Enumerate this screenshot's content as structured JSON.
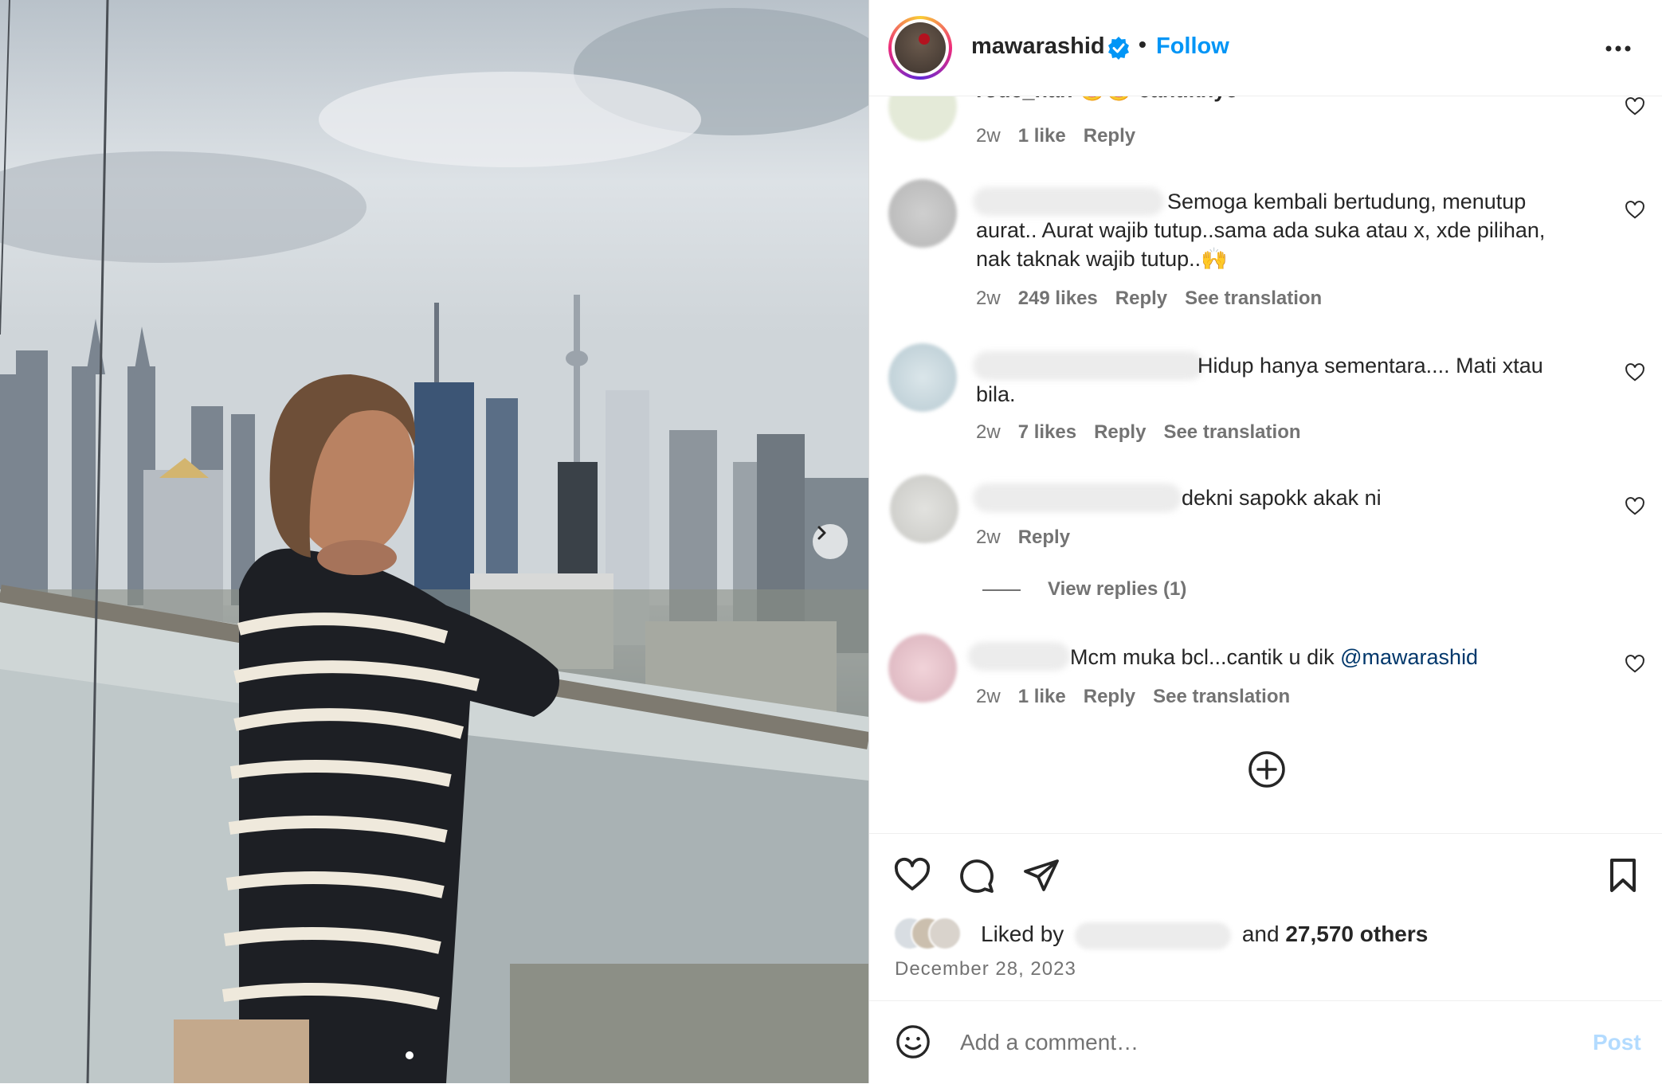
{
  "post": {
    "username": "mawarashid",
    "separator": "•",
    "follow_label": "Follow",
    "more_icon": "more-horizontal-icon",
    "verified_color": "#0095f6",
    "follow_color": "#0095f6"
  },
  "photo": {
    "next_icon": "chevron-right-icon",
    "carousel_index": 1
  },
  "comments": [
    {
      "text": "rode_nan 😄😄 cantiknye",
      "time": "2w",
      "likes": "1 like",
      "reply": "Reply",
      "translate": ""
    },
    {
      "text": "Semoga kembali bertudung, menutup aurat.. Aurat wajib tutup..sama ada suka atau x, xde pilihan, nak taknak wajib tutup..🙌",
      "line1": "Semoga kembali bertudung, menutup",
      "line2": "aurat.. Aurat wajib tutup..sama ada suka atau x, xde pilihan,",
      "line3": "nak taknak wajib tutup..🙌",
      "time": "2w",
      "likes": "249 likes",
      "reply": "Reply",
      "translate": "See translation"
    },
    {
      "line1": "Hidup hanya sementara.... Mati xtau",
      "line2": "bila.",
      "time": "2w",
      "likes": "7 likes",
      "reply": "Reply",
      "translate": "See translation"
    },
    {
      "line1": "dekni sapokk akak ni",
      "time": "2w",
      "reply": "Reply"
    },
    {
      "line1": "Mcm muka bcl...cantik u dik ",
      "mention": "@mawarashid",
      "time": "2w",
      "likes": "1 like",
      "reply": "Reply",
      "translate": "See translation"
    }
  ],
  "view_replies": "View replies (1)",
  "likes": {
    "liked_by": "Liked by",
    "and": "and",
    "others": "27,570 others"
  },
  "date": "December 28, 2023",
  "comment_box": {
    "placeholder": "Add a comment…",
    "post_label": "Post",
    "post_color": "#b3dbff"
  }
}
